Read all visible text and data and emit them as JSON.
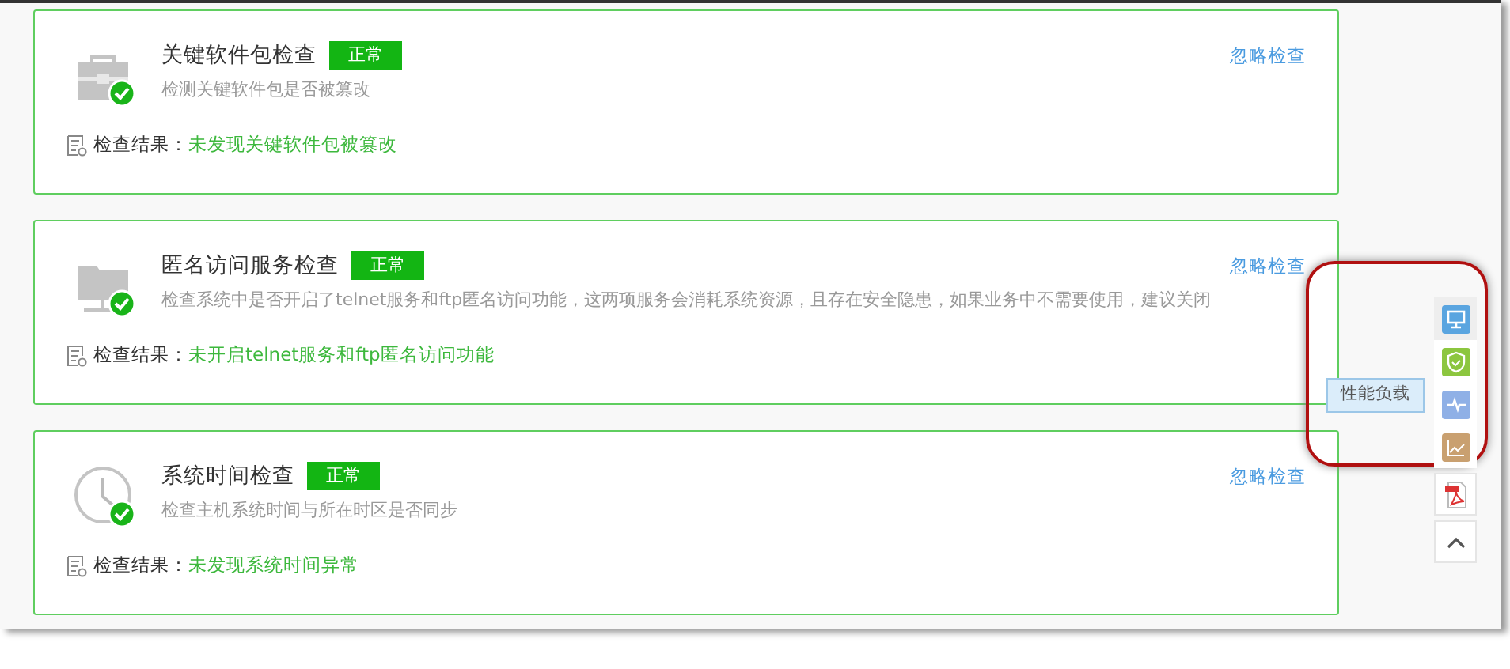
{
  "checks": [
    {
      "kind": "package",
      "title": "关键软件包检查",
      "status": "正常",
      "description": "检测关键软件包是否被篡改",
      "result_label": "检查结果：",
      "result": "未发现关键软件包被篡改",
      "action": "忽略检查"
    },
    {
      "kind": "network",
      "title": "匿名访问服务检查",
      "status": "正常",
      "description": "检查系统中是否开启了telnet服务和ftp匿名访问功能，这两项服务会消耗系统资源，且存在安全隐患，如果业务中不需要使用，建议关闭",
      "result_label": "检查结果：",
      "result": "未开启telnet服务和ftp匿名访问功能",
      "action": "忽略检查"
    },
    {
      "kind": "clock",
      "title": "系统时间检查",
      "status": "正常",
      "description": "检查主机系统时间与所在时区是否同步",
      "result_label": "检查结果：",
      "result": "未发现系统时间异常",
      "action": "忽略检查"
    }
  ],
  "side_toolbar": [
    {
      "kind": "monitor",
      "color": "#5aa5e0",
      "selected": true
    },
    {
      "kind": "shield",
      "color": "#8cc63f",
      "selected": false
    },
    {
      "kind": "pulse",
      "color": "#8fb0e6",
      "selected": false,
      "tooltip": "性能负载"
    },
    {
      "kind": "chart",
      "color": "#c9a070",
      "selected": false
    },
    {
      "kind": "pdf",
      "selected": false
    },
    {
      "kind": "top",
      "selected": false
    }
  ]
}
